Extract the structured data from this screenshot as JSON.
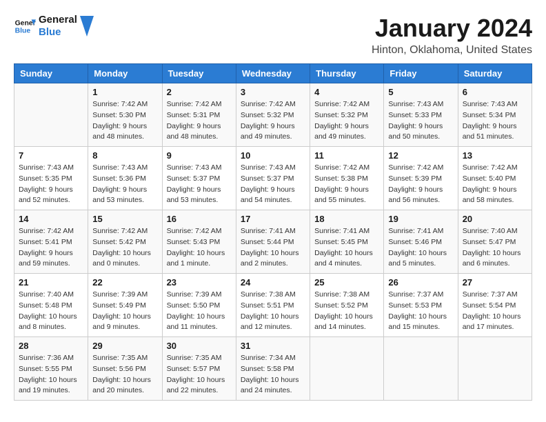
{
  "header": {
    "logo_line1": "General",
    "logo_line2": "Blue",
    "month": "January 2024",
    "location": "Hinton, Oklahoma, United States"
  },
  "weekdays": [
    "Sunday",
    "Monday",
    "Tuesday",
    "Wednesday",
    "Thursday",
    "Friday",
    "Saturday"
  ],
  "weeks": [
    [
      {
        "day": "",
        "info": ""
      },
      {
        "day": "1",
        "info": "Sunrise: 7:42 AM\nSunset: 5:30 PM\nDaylight: 9 hours\nand 48 minutes."
      },
      {
        "day": "2",
        "info": "Sunrise: 7:42 AM\nSunset: 5:31 PM\nDaylight: 9 hours\nand 48 minutes."
      },
      {
        "day": "3",
        "info": "Sunrise: 7:42 AM\nSunset: 5:32 PM\nDaylight: 9 hours\nand 49 minutes."
      },
      {
        "day": "4",
        "info": "Sunrise: 7:42 AM\nSunset: 5:32 PM\nDaylight: 9 hours\nand 49 minutes."
      },
      {
        "day": "5",
        "info": "Sunrise: 7:43 AM\nSunset: 5:33 PM\nDaylight: 9 hours\nand 50 minutes."
      },
      {
        "day": "6",
        "info": "Sunrise: 7:43 AM\nSunset: 5:34 PM\nDaylight: 9 hours\nand 51 minutes."
      }
    ],
    [
      {
        "day": "7",
        "info": "Sunrise: 7:43 AM\nSunset: 5:35 PM\nDaylight: 9 hours\nand 52 minutes."
      },
      {
        "day": "8",
        "info": "Sunrise: 7:43 AM\nSunset: 5:36 PM\nDaylight: 9 hours\nand 53 minutes."
      },
      {
        "day": "9",
        "info": "Sunrise: 7:43 AM\nSunset: 5:37 PM\nDaylight: 9 hours\nand 53 minutes."
      },
      {
        "day": "10",
        "info": "Sunrise: 7:43 AM\nSunset: 5:37 PM\nDaylight: 9 hours\nand 54 minutes."
      },
      {
        "day": "11",
        "info": "Sunrise: 7:42 AM\nSunset: 5:38 PM\nDaylight: 9 hours\nand 55 minutes."
      },
      {
        "day": "12",
        "info": "Sunrise: 7:42 AM\nSunset: 5:39 PM\nDaylight: 9 hours\nand 56 minutes."
      },
      {
        "day": "13",
        "info": "Sunrise: 7:42 AM\nSunset: 5:40 PM\nDaylight: 9 hours\nand 58 minutes."
      }
    ],
    [
      {
        "day": "14",
        "info": "Sunrise: 7:42 AM\nSunset: 5:41 PM\nDaylight: 9 hours\nand 59 minutes."
      },
      {
        "day": "15",
        "info": "Sunrise: 7:42 AM\nSunset: 5:42 PM\nDaylight: 10 hours\nand 0 minutes."
      },
      {
        "day": "16",
        "info": "Sunrise: 7:42 AM\nSunset: 5:43 PM\nDaylight: 10 hours\nand 1 minute."
      },
      {
        "day": "17",
        "info": "Sunrise: 7:41 AM\nSunset: 5:44 PM\nDaylight: 10 hours\nand 2 minutes."
      },
      {
        "day": "18",
        "info": "Sunrise: 7:41 AM\nSunset: 5:45 PM\nDaylight: 10 hours\nand 4 minutes."
      },
      {
        "day": "19",
        "info": "Sunrise: 7:41 AM\nSunset: 5:46 PM\nDaylight: 10 hours\nand 5 minutes."
      },
      {
        "day": "20",
        "info": "Sunrise: 7:40 AM\nSunset: 5:47 PM\nDaylight: 10 hours\nand 6 minutes."
      }
    ],
    [
      {
        "day": "21",
        "info": "Sunrise: 7:40 AM\nSunset: 5:48 PM\nDaylight: 10 hours\nand 8 minutes."
      },
      {
        "day": "22",
        "info": "Sunrise: 7:39 AM\nSunset: 5:49 PM\nDaylight: 10 hours\nand 9 minutes."
      },
      {
        "day": "23",
        "info": "Sunrise: 7:39 AM\nSunset: 5:50 PM\nDaylight: 10 hours\nand 11 minutes."
      },
      {
        "day": "24",
        "info": "Sunrise: 7:38 AM\nSunset: 5:51 PM\nDaylight: 10 hours\nand 12 minutes."
      },
      {
        "day": "25",
        "info": "Sunrise: 7:38 AM\nSunset: 5:52 PM\nDaylight: 10 hours\nand 14 minutes."
      },
      {
        "day": "26",
        "info": "Sunrise: 7:37 AM\nSunset: 5:53 PM\nDaylight: 10 hours\nand 15 minutes."
      },
      {
        "day": "27",
        "info": "Sunrise: 7:37 AM\nSunset: 5:54 PM\nDaylight: 10 hours\nand 17 minutes."
      }
    ],
    [
      {
        "day": "28",
        "info": "Sunrise: 7:36 AM\nSunset: 5:55 PM\nDaylight: 10 hours\nand 19 minutes."
      },
      {
        "day": "29",
        "info": "Sunrise: 7:35 AM\nSunset: 5:56 PM\nDaylight: 10 hours\nand 20 minutes."
      },
      {
        "day": "30",
        "info": "Sunrise: 7:35 AM\nSunset: 5:57 PM\nDaylight: 10 hours\nand 22 minutes."
      },
      {
        "day": "31",
        "info": "Sunrise: 7:34 AM\nSunset: 5:58 PM\nDaylight: 10 hours\nand 24 minutes."
      },
      {
        "day": "",
        "info": ""
      },
      {
        "day": "",
        "info": ""
      },
      {
        "day": "",
        "info": ""
      }
    ]
  ]
}
